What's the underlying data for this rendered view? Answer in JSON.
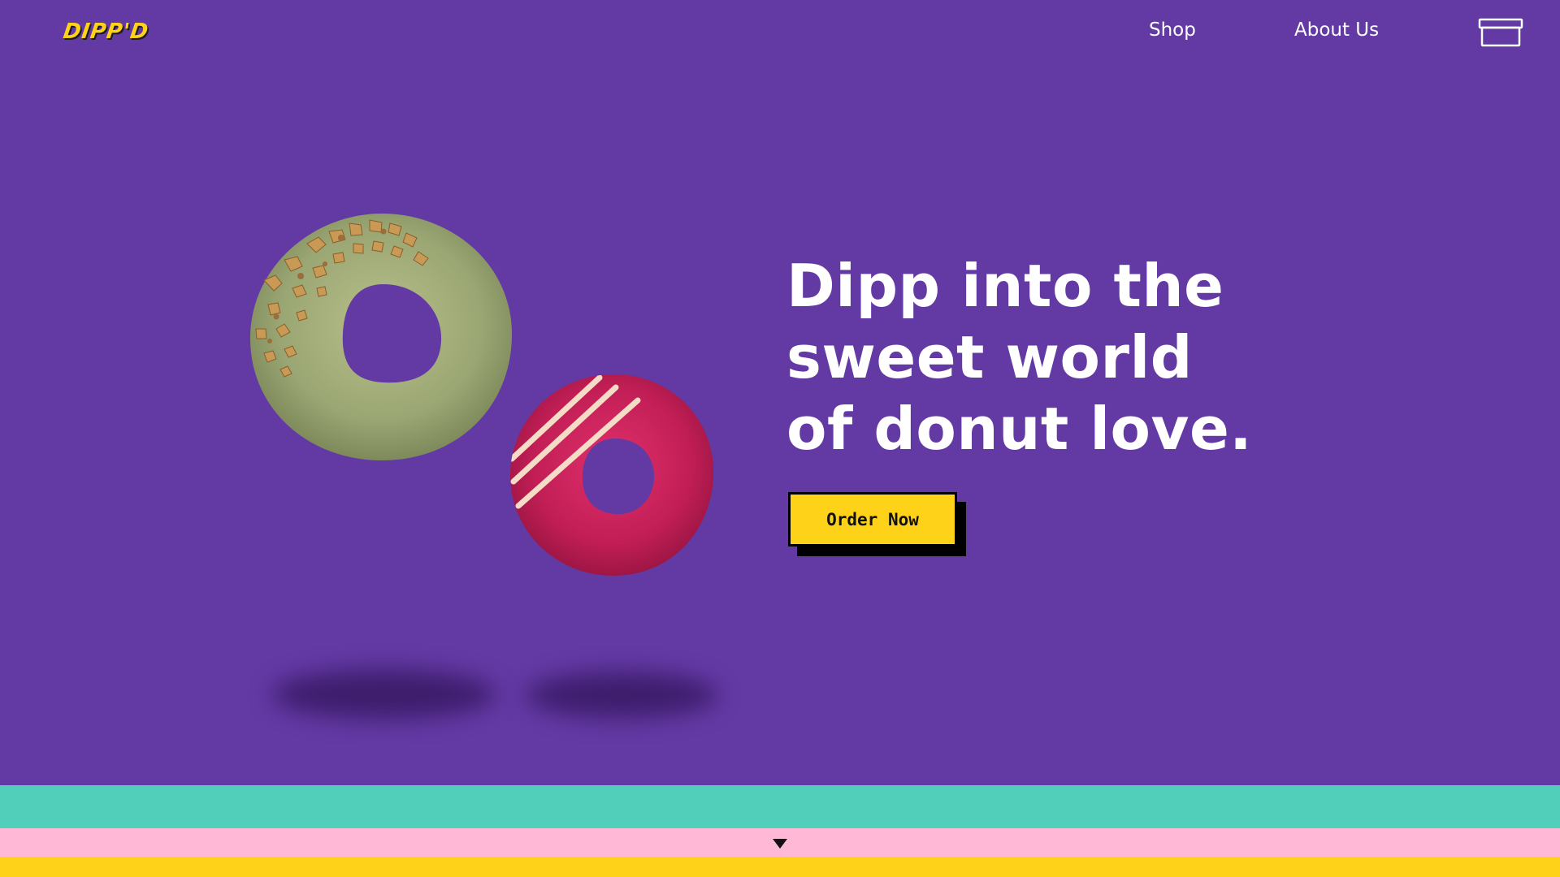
{
  "brand": {
    "logo_text": "DIPP'D",
    "logo_color": "#ffd21a"
  },
  "nav": {
    "items": [
      {
        "label": "Shop"
      },
      {
        "label": "About Us"
      }
    ],
    "cart_icon": "box-icon"
  },
  "hero": {
    "title_lines": [
      "Dipp into the",
      "sweet world",
      "of donut love."
    ],
    "cta_label": "Order Now",
    "images": [
      {
        "name": "pistachio-donut",
        "description_icon": "green-glazed-donut-with-nuts"
      },
      {
        "name": "raspberry-donut",
        "description_icon": "pink-glazed-donut-with-stripes"
      }
    ]
  },
  "footer_stripes": {
    "colors": [
      "#52cfba",
      "#ffb9d6",
      "#ffd21a"
    ],
    "scroll_icon": "down-triangle-icon"
  },
  "colors": {
    "background": "#6339a4",
    "cta": "#ffd21a",
    "text": "#ffffff"
  }
}
